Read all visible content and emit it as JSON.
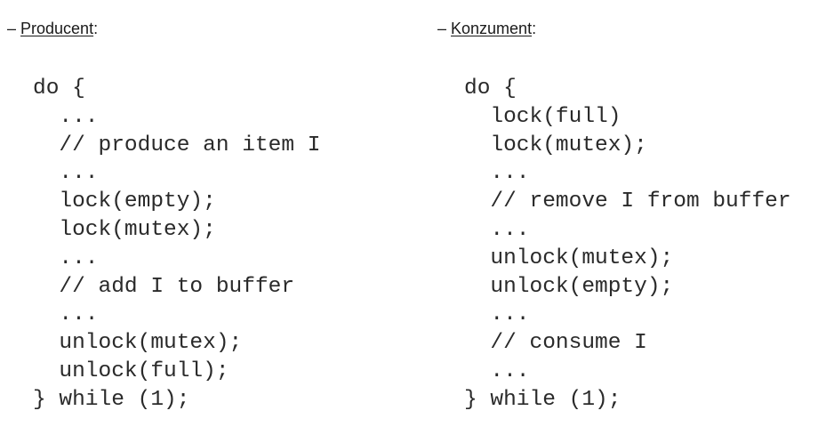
{
  "producer": {
    "dash": "– ",
    "title": "Producent",
    "colon": ":",
    "code_lines": [
      "do {",
      "  ...",
      "  // produce an item I",
      "  ...",
      "  lock(empty);",
      "  lock(mutex);",
      "  ...",
      "  // add I to buffer",
      "  ...",
      "  unlock(mutex);",
      "  unlock(full);",
      "} while (1);"
    ]
  },
  "consumer": {
    "dash": "– ",
    "title": "Konzument",
    "colon": ":",
    "code_lines": [
      "do {",
      "  lock(full)",
      "  lock(mutex);",
      "  ...",
      "  // remove I from buffer",
      "  ...",
      "  unlock(mutex);",
      "  unlock(empty);",
      "  ...",
      "  // consume I",
      "  ...",
      "} while (1);"
    ]
  }
}
